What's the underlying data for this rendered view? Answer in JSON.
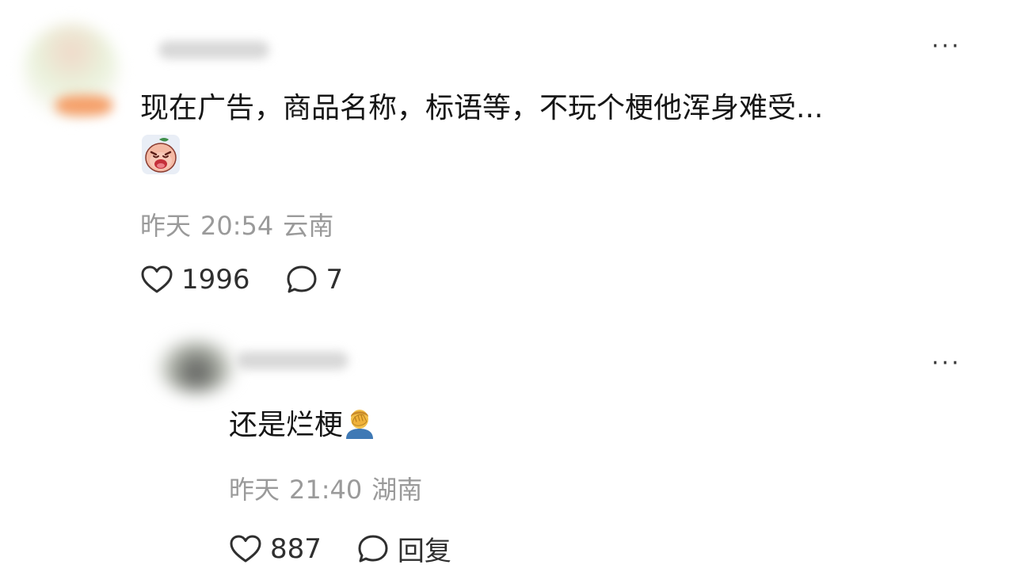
{
  "main_comment": {
    "text": "现在广告，商品名称，标语等，不玩个梗他浑身难受...",
    "sticker_icon": "crying-peach-face-icon",
    "meta": {
      "date": "昨天",
      "time": "20:54",
      "location": "云南"
    },
    "likes": "1996",
    "replies": "7",
    "more_label": "···"
  },
  "reply_comment": {
    "text": "还是烂梗",
    "emoji_icon": "man-facepalming-icon",
    "meta": {
      "date": "昨天",
      "time": "21:40",
      "location": "湖南"
    },
    "likes": "887",
    "reply_label": "回复",
    "more_label": "···"
  }
}
